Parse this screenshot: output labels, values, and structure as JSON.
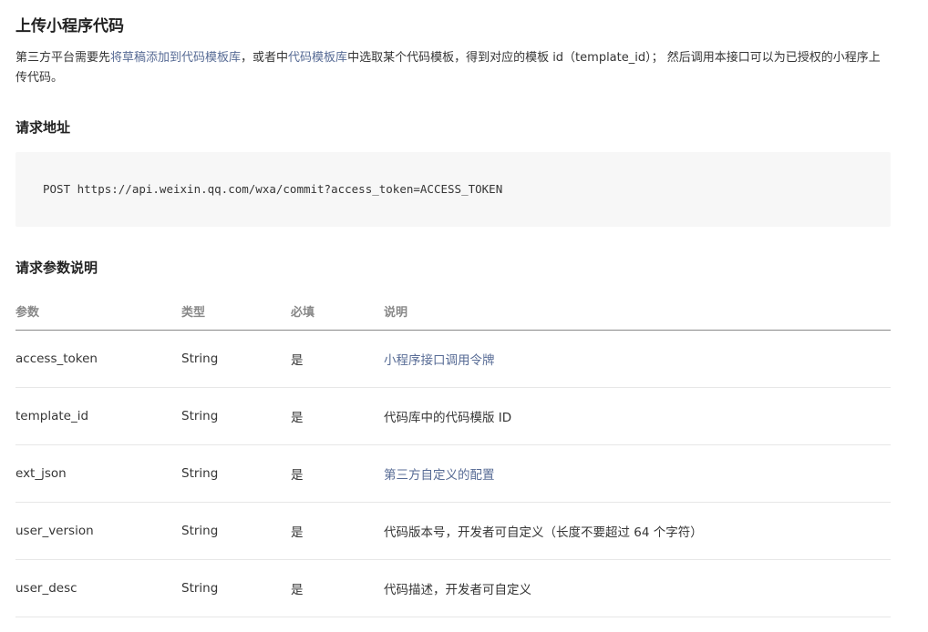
{
  "page": {
    "title": "上传小程序代码",
    "description": {
      "part1": "第三方平台需要先",
      "link1": "将草稿添加到代码模板库",
      "part2": "，或者中",
      "link2": "代码模板库",
      "part3": "中选取某个代码模板，得到对应的模板 id（template_id）； 然后调用本接口可以为已授权的小程序上传代码。"
    }
  },
  "request_url": {
    "heading": "请求地址",
    "code": "POST https://api.weixin.qq.com/wxa/commit?access_token=ACCESS_TOKEN"
  },
  "params": {
    "heading": "请求参数说明",
    "columns": [
      "参数",
      "类型",
      "必填",
      "说明"
    ],
    "rows": [
      {
        "name": "access_token",
        "type": "String",
        "required": "是",
        "desc": "小程序接口调用令牌",
        "desc_is_link": true
      },
      {
        "name": "template_id",
        "type": "String",
        "required": "是",
        "desc": "代码库中的代码模版 ID",
        "desc_is_link": false
      },
      {
        "name": "ext_json",
        "type": "String",
        "required": "是",
        "desc": "第三方自定义的配置",
        "desc_is_link": true
      },
      {
        "name": "user_version",
        "type": "String",
        "required": "是",
        "desc": "代码版本号，开发者可自定义（长度不要超过 64 个字符）",
        "desc_is_link": false
      },
      {
        "name": "user_desc",
        "type": "String",
        "required": "是",
        "desc": "代码描述，开发者可自定义",
        "desc_is_link": false
      }
    ]
  },
  "colors": {
    "link": "#576b95",
    "text": "#353535",
    "code_bg": "#f7f7f7",
    "header_text": "#888888"
  }
}
